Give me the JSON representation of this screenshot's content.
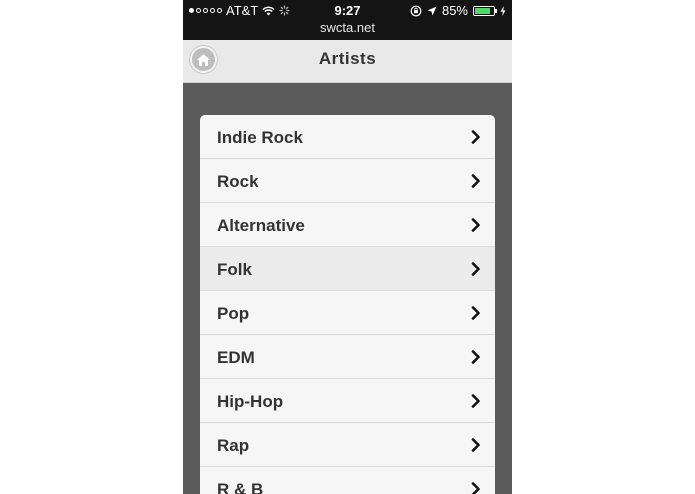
{
  "status_bar": {
    "carrier": "AT&T",
    "time": "9:27",
    "url": "swcta.net",
    "battery": "85%",
    "battery_level": 0.85,
    "signal_bars_filled": 1,
    "signal_bars_total": 5,
    "icons": [
      "signal-icon",
      "wifi-icon",
      "loading-icon",
      "rotation-lock-icon",
      "location-icon",
      "battery-icon",
      "charging-icon"
    ]
  },
  "header": {
    "title": "Artists",
    "home_icon": "home-icon"
  },
  "list": {
    "items": [
      {
        "label": "Indie Rock"
      },
      {
        "label": "Rock"
      },
      {
        "label": "Alternative"
      },
      {
        "label": "Folk"
      },
      {
        "label": "Pop"
      },
      {
        "label": "EDM"
      },
      {
        "label": "Hip-Hop"
      },
      {
        "label": "Rap"
      },
      {
        "label": "R & B"
      }
    ],
    "active_item": "Folk",
    "chevron_icon": "chevron-right-icon"
  },
  "colors": {
    "status_bar_bg": "#141414",
    "header_bg": "#e9e9e9",
    "page_bg": "#5b5b5b",
    "list_bg": "#f6f6f6",
    "battery_fill": "#4cd964"
  }
}
